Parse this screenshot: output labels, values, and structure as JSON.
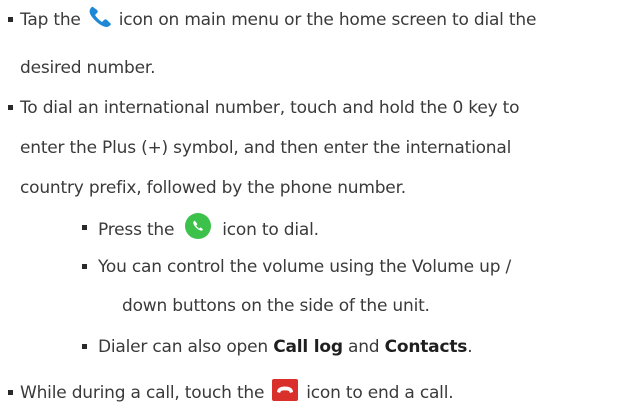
{
  "items": [
    {
      "line1_pre": "Tap the",
      "line1_post": "icon on main menu or the home screen to dial the",
      "line2": "desired number."
    },
    {
      "line1": "To dial an international number, touch and hold the 0 key to",
      "line2": "enter the Plus (+) symbol, and then enter the international",
      "line3": "country prefix, followed by the phone number."
    }
  ],
  "subitems": [
    {
      "pre": "Press the",
      "post": "icon to dial."
    },
    {
      "line1": "You can control the volume using the Volume up /",
      "line2": "down buttons on the side of the unit."
    },
    {
      "pre": "Dialer can also open ",
      "bold1": "Call log",
      "mid": " and ",
      "bold2": "Contacts",
      "post": "."
    }
  ],
  "last_item": {
    "pre": "While during a call, touch the",
    "post": "icon to end a call."
  },
  "icons": {
    "phone": "phone-icon",
    "dial": "dial-button-icon",
    "end": "end-call-icon"
  },
  "colors": {
    "phone_icon": "#1e88d6",
    "dial_icon": "#3cc24a",
    "end_icon": "#d9302c"
  }
}
